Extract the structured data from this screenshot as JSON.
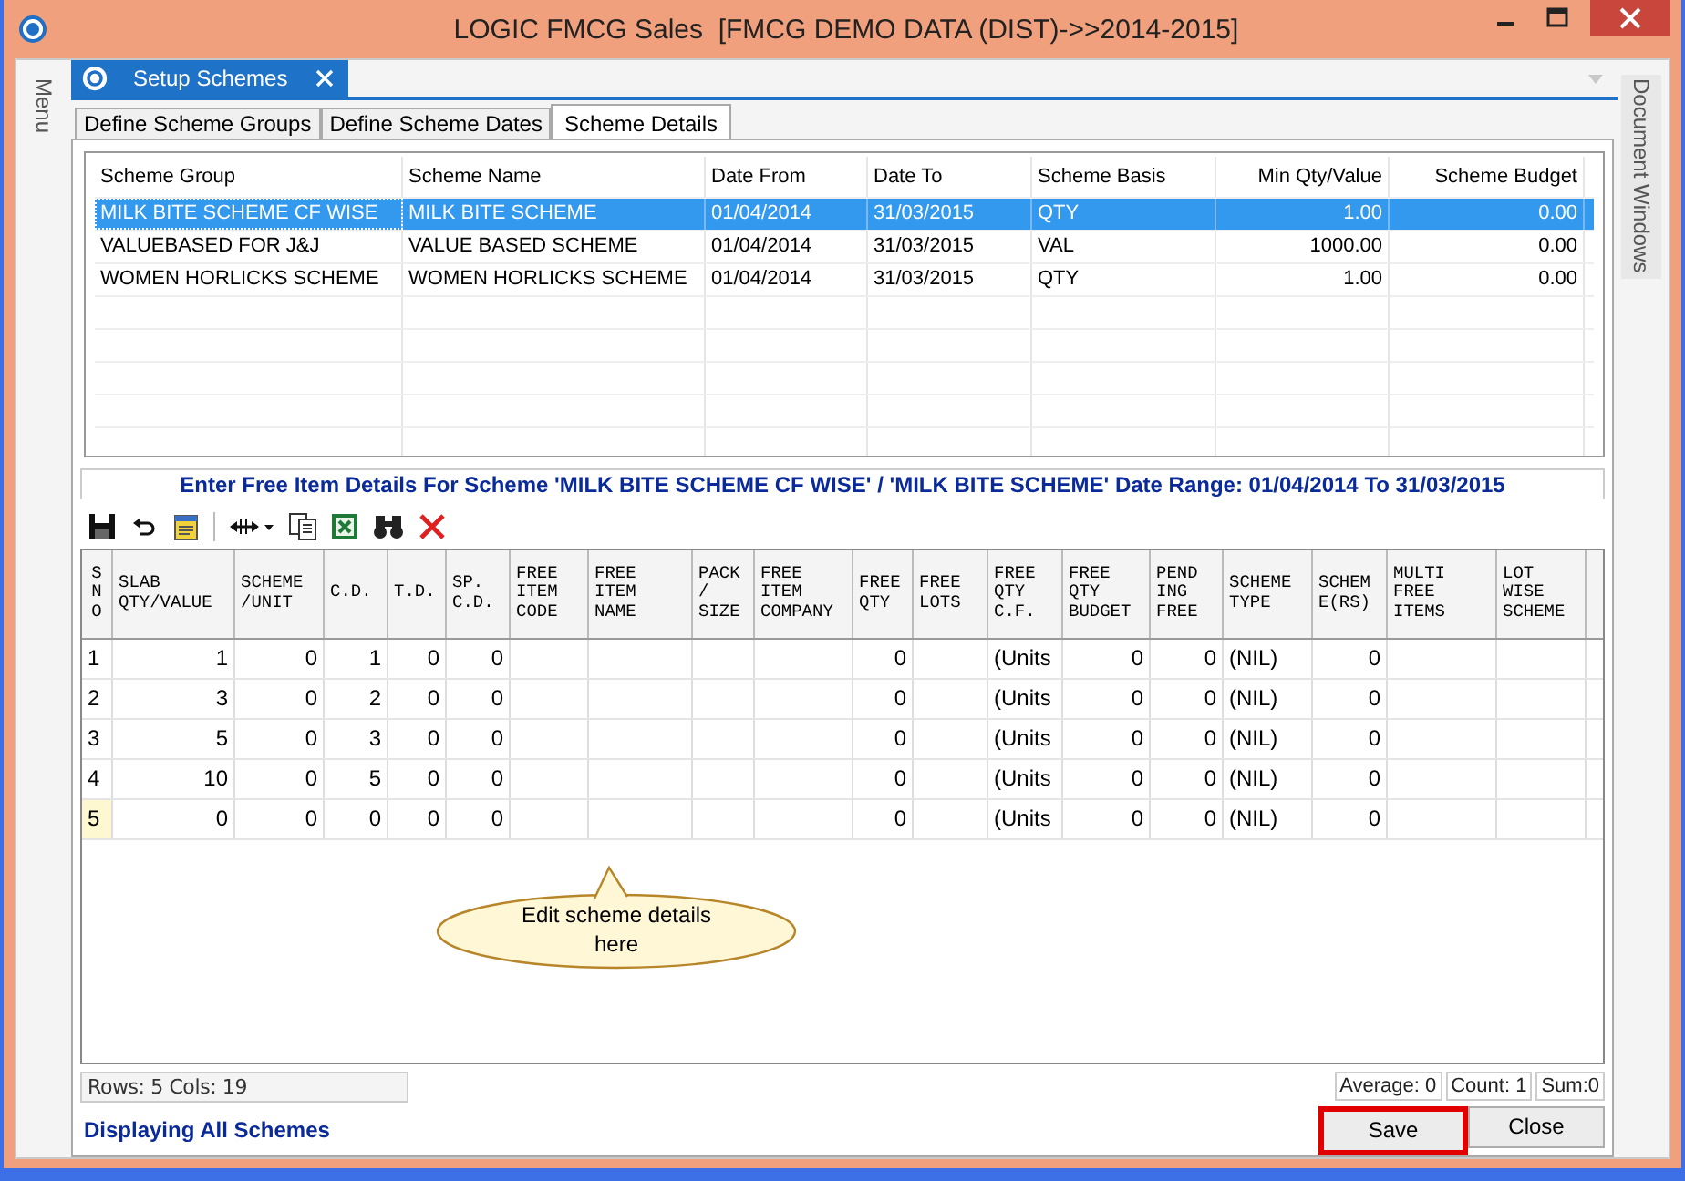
{
  "window": {
    "title": "LOGIC FMCG Sales  [FMCG DEMO DATA (DIST)->>2014-2015]"
  },
  "side_panels": {
    "left": "Menu",
    "right": "Document Windows"
  },
  "document_tab": {
    "title": "Setup Schemes"
  },
  "tabs": [
    {
      "label": "Define Scheme Groups",
      "selected": false
    },
    {
      "label": "Define Scheme Dates",
      "selected": false
    },
    {
      "label": "Scheme Details",
      "selected": true
    }
  ],
  "schemes": {
    "columns": [
      {
        "label": "Scheme Group",
        "kind": "text"
      },
      {
        "label": "Scheme Name",
        "kind": "text"
      },
      {
        "label": "Date From",
        "kind": "text"
      },
      {
        "label": "Date To",
        "kind": "text"
      },
      {
        "label": "Scheme Basis",
        "kind": "text"
      },
      {
        "label": "Min Qty/Value",
        "kind": "number"
      },
      {
        "label": "Scheme Budget",
        "kind": "number"
      }
    ],
    "rows": [
      {
        "selected": true,
        "cells": [
          "MILK BITE SCHEME CF WISE",
          "MILK BITE SCHEME",
          "01/04/2014",
          "31/03/2015",
          "QTY",
          "1.00",
          "0.00"
        ]
      },
      {
        "selected": false,
        "cells": [
          "VALUEBASED FOR J&J",
          "VALUE BASED SCHEME",
          "01/04/2014",
          "31/03/2015",
          "VAL",
          "1000.00",
          "0.00"
        ]
      },
      {
        "selected": false,
        "cells": [
          "WOMEN HORLICKS SCHEME",
          "WOMEN HORLICKS SCHEME",
          "01/04/2014",
          "31/03/2015",
          "QTY",
          "1.00",
          "0.00"
        ]
      }
    ]
  },
  "detail_caption": "Enter Free Item Details For Scheme 'MILK BITE SCHEME CF WISE' / 'MILK BITE SCHEME'  Date Range: 01/04/2014 To 31/03/2015",
  "toolbar": [
    {
      "kind": "save"
    },
    {
      "kind": "undo"
    },
    {
      "kind": "notes"
    },
    {
      "kind": "resize"
    },
    {
      "kind": "copy"
    },
    {
      "kind": "excel"
    },
    {
      "kind": "find"
    },
    {
      "kind": "delete"
    }
  ],
  "details": {
    "columns": [
      {
        "label": "SNO",
        "kind": "vertical"
      },
      {
        "label": "SLAB QTY/VALUE",
        "kind": "number"
      },
      {
        "label": "SCHEME /UNIT",
        "kind": "number"
      },
      {
        "label": "C.D.",
        "kind": "number"
      },
      {
        "label": "T.D.",
        "kind": "number"
      },
      {
        "label": "SP. C.D.",
        "kind": "number"
      },
      {
        "label": "FREE ITEM CODE",
        "kind": "text"
      },
      {
        "label": "FREE ITEM NAME",
        "kind": "text"
      },
      {
        "label": "PACK / SIZE",
        "kind": "text"
      },
      {
        "label": "FREE ITEM COMPANY",
        "kind": "text"
      },
      {
        "label": "FREE QTY",
        "kind": "number"
      },
      {
        "label": "FREE LOTS",
        "kind": "number"
      },
      {
        "label": "FREE QTY C.F.",
        "kind": "text"
      },
      {
        "label": "FREE QTY BUDGET",
        "kind": "number"
      },
      {
        "label": "PEND ING FREE",
        "kind": "number"
      },
      {
        "label": "SCHEME TYPE",
        "kind": "text"
      },
      {
        "label": "SCHEM E(RS)",
        "kind": "number"
      },
      {
        "label": "MULTI FREE ITEMS",
        "kind": "text"
      },
      {
        "label": "LOT WISE SCHEME",
        "kind": "text"
      }
    ],
    "rows": [
      {
        "current": false,
        "cells": [
          "1",
          "1",
          "0",
          "1",
          "0",
          "0",
          null,
          null,
          null,
          null,
          "0",
          null,
          "(Units",
          "0",
          "0",
          "(NIL)",
          "0",
          null,
          null
        ]
      },
      {
        "current": false,
        "cells": [
          "2",
          "3",
          "0",
          "2",
          "0",
          "0",
          null,
          null,
          null,
          null,
          "0",
          null,
          "(Units",
          "0",
          "0",
          "(NIL)",
          "0",
          null,
          null
        ]
      },
      {
        "current": false,
        "cells": [
          "3",
          "5",
          "0",
          "3",
          "0",
          "0",
          null,
          null,
          null,
          null,
          "0",
          null,
          "(Units",
          "0",
          "0",
          "(NIL)",
          "0",
          null,
          null
        ]
      },
      {
        "current": false,
        "cells": [
          "4",
          "10",
          "0",
          "5",
          "0",
          "0",
          null,
          null,
          null,
          null,
          "0",
          null,
          "(Units",
          "0",
          "0",
          "(NIL)",
          "0",
          null,
          null
        ]
      },
      {
        "current": true,
        "cells": [
          "5",
          "0",
          "0",
          "0",
          "0",
          "0",
          null,
          null,
          null,
          null,
          "0",
          null,
          "(Units",
          "0",
          "0",
          "(NIL)",
          "0",
          null,
          null
        ]
      }
    ]
  },
  "callout": "Edit scheme details here",
  "grid_status": "Rows: 5  Cols: 19",
  "summary": [
    "Average: 0",
    "Count: 1",
    "Sum:0"
  ],
  "status_message": "Displaying All Schemes",
  "buttons": [
    {
      "label": "Save",
      "highlighted": true
    },
    {
      "label": "Close",
      "highlighted": false
    }
  ]
}
